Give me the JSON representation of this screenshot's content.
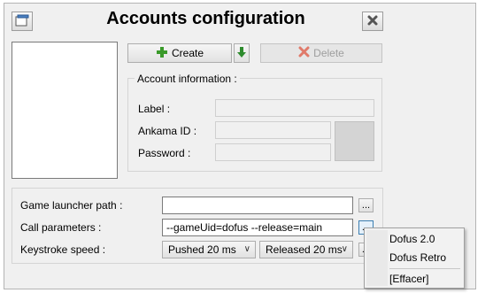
{
  "window": {
    "title": "Accounts configuration"
  },
  "toolbar": {
    "create_label": "Create",
    "delete_label": "Delete"
  },
  "account_info": {
    "legend": "Account information :",
    "label_label": "Label :",
    "ankama_id_label": "Ankama ID :",
    "password_label": "Password :"
  },
  "settings": {
    "game_launcher_label": "Game launcher path :",
    "game_launcher_value": "",
    "call_params_label": "Call parameters :",
    "call_params_value": "--gameUid=dofus --release=main",
    "keystroke_label": "Keystroke speed :",
    "pushed_value": "Pushed 20 ms",
    "released_value": "Released 20 ms",
    "browse_label": "..."
  },
  "context_menu": {
    "items": [
      "Dofus 2.0",
      "Dofus Retro",
      "[Effacer]"
    ]
  },
  "colors": {
    "create_icon": "#3a9a2a",
    "delete_icon": "#e07a6a",
    "down_arrow": "#2e8b2e"
  }
}
